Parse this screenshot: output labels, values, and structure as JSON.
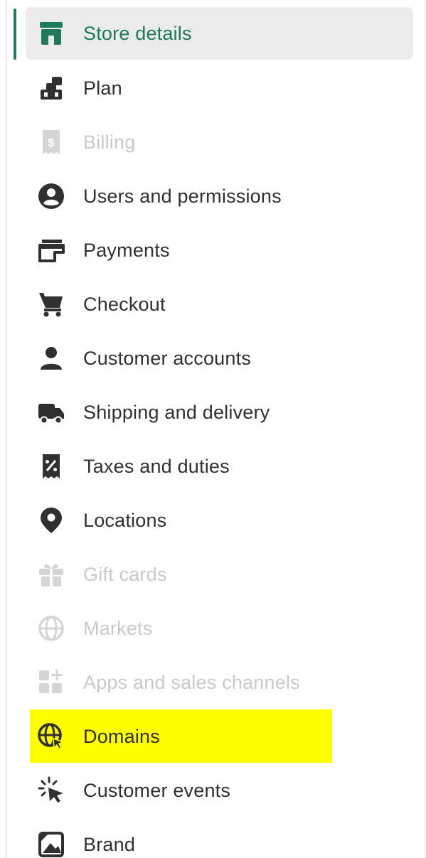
{
  "colors": {
    "accent": "#1f7a5c",
    "text": "#303030",
    "disabled_text": "#c9c9c9",
    "selected_bg": "#ebebeb",
    "highlight": "#ffff00"
  },
  "settings_nav": {
    "items": [
      {
        "label": "Store details",
        "icon": "store-icon"
      },
      {
        "label": "Plan",
        "icon": "plan-icon"
      },
      {
        "label": "Billing",
        "icon": "billing-receipt-icon"
      },
      {
        "label": "Users and permissions",
        "icon": "user-circle-icon"
      },
      {
        "label": "Payments",
        "icon": "payments-card-icon"
      },
      {
        "label": "Checkout",
        "icon": "cart-icon"
      },
      {
        "label": "Customer accounts",
        "icon": "person-icon"
      },
      {
        "label": "Shipping and delivery",
        "icon": "truck-icon"
      },
      {
        "label": "Taxes and duties",
        "icon": "tax-receipt-icon"
      },
      {
        "label": "Locations",
        "icon": "location-pin-icon"
      },
      {
        "label": "Gift cards",
        "icon": "gift-icon"
      },
      {
        "label": "Markets",
        "icon": "globe-icon"
      },
      {
        "label": "Apps and sales channels",
        "icon": "apps-grid-icon"
      },
      {
        "label": "Domains",
        "icon": "globe-cursor-icon"
      },
      {
        "label": "Customer events",
        "icon": "click-cursor-icon"
      },
      {
        "label": "Brand",
        "icon": "brand-image-icon"
      }
    ],
    "selected_item": "Store details",
    "highlighted_item": "Domains",
    "disabled_items": [
      "Billing",
      "Gift cards",
      "Markets",
      "Apps and sales channels"
    ]
  }
}
